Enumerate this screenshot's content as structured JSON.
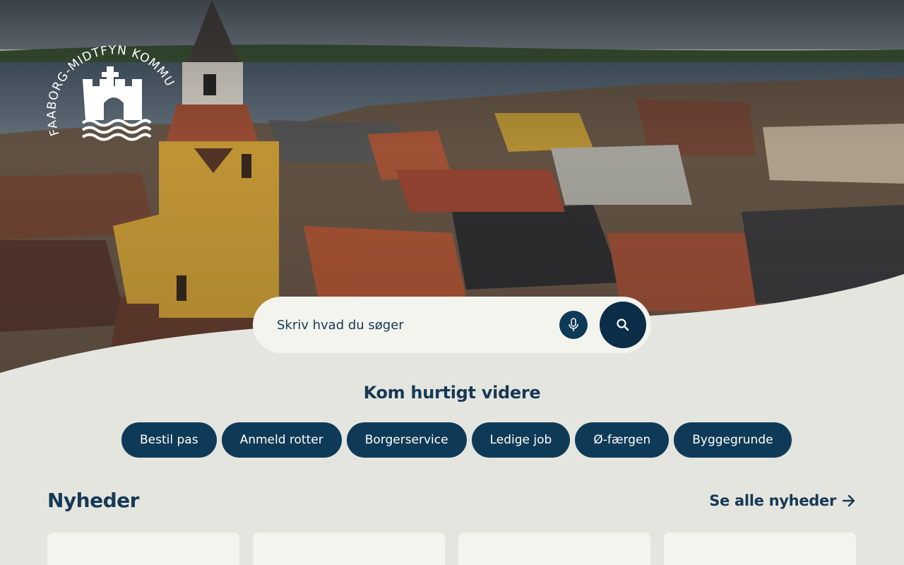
{
  "logo": {
    "text": "FAABORG-MIDTFYN KOMMUNE"
  },
  "search": {
    "placeholder": "Skriv hvad du søger",
    "mic_icon": "microphone-icon",
    "search_icon": "search-icon"
  },
  "quick": {
    "title": "Kom hurtigt videre",
    "links": [
      "Bestil pas",
      "Anmeld rotter",
      "Borgerservice",
      "Ledige job",
      "Ø-færgen",
      "Byggegrunde"
    ]
  },
  "news": {
    "title": "Nyheder",
    "see_all": "Se alle nyheder",
    "arrow_icon": "arrow-right-icon"
  },
  "colors": {
    "brand_dark": "#0e3a57",
    "heading": "#163a55",
    "background": "#e5e5e0"
  }
}
